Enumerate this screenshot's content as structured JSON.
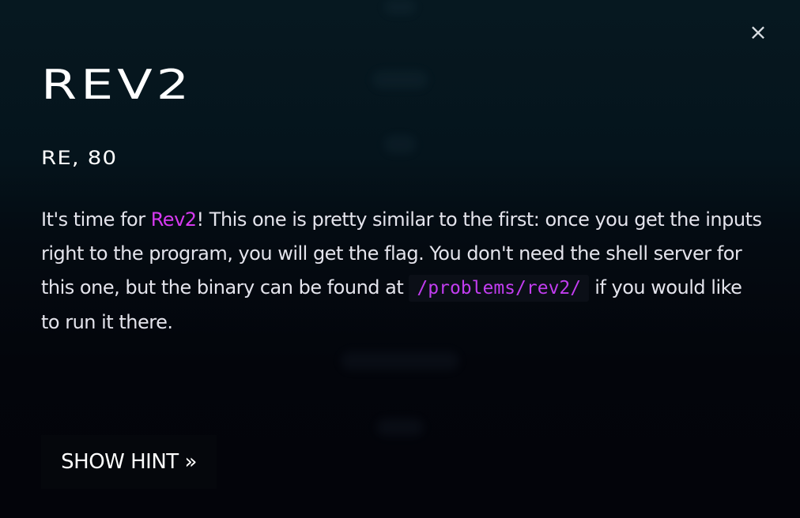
{
  "modal": {
    "close_icon": "×",
    "title": "REV2",
    "subtitle": "RE, 80",
    "description": {
      "part1": "It's time for ",
      "highlight": "Rev2",
      "part2": "! This one is pretty similar to the first: once you get the inputs right to the program, you will get the flag. You don't need the shell server for this one, but the binary can be found at ",
      "code": "/problems/rev2/",
      "part3": " if you would like to run it there."
    },
    "hint_button_label": "SHOW HINT »"
  },
  "colors": {
    "accent": "#d63af0",
    "code_text": "#c23df0",
    "background_top": "#061820",
    "background_bottom": "#03040a"
  }
}
